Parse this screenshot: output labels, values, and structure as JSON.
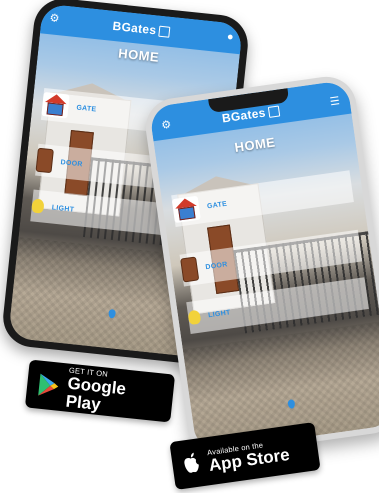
{
  "app": {
    "logo_text": "BGates",
    "home_title": "HOME",
    "devices": [
      {
        "label": "GATE",
        "icon": "garage-icon"
      },
      {
        "label": "DOOR",
        "icon": "door-icon"
      },
      {
        "label": "LIGHT",
        "icon": "bulb-icon"
      }
    ]
  },
  "stores": {
    "google": {
      "small": "GET IT ON",
      "big": "Google Play",
      "icon": "google-play-icon"
    },
    "apple": {
      "small": "Available on the",
      "big": "App Store",
      "icon": "apple-icon"
    }
  },
  "colors": {
    "accent": "#2d8fe0",
    "badge_bg": "#000000"
  }
}
